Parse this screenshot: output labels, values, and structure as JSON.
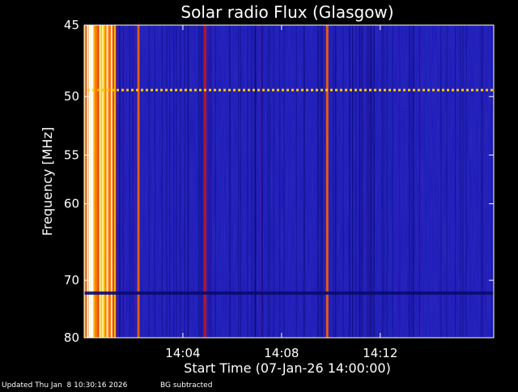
{
  "chart_data": {
    "type": "heatmap",
    "title": "Solar radio Flux (Glasgow)",
    "xlabel": "Start Time (07-Jan-26 14:00:00)",
    "ylabel": "Frequency [MHz]",
    "x_unit": "minutes after 14:00:00",
    "xlim": [
      0,
      16.6
    ],
    "ylim": [
      45,
      80
    ],
    "y_scale": "reciprocal",
    "x_ticks": [
      {
        "value": 4,
        "label": "14:04"
      },
      {
        "value": 8,
        "label": "14:08"
      },
      {
        "value": 12,
        "label": "14:12"
      }
    ],
    "y_ticks": [
      {
        "value": 45,
        "label": "45"
      },
      {
        "value": 50,
        "label": "50"
      },
      {
        "value": 55,
        "label": "55"
      },
      {
        "value": 60,
        "label": "60"
      },
      {
        "value": 70,
        "label": "70"
      },
      {
        "value": 80,
        "label": "80"
      }
    ],
    "colormap": [
      "#000000",
      "#0a0a6e",
      "#1e1ec8",
      "#5a0aa0",
      "#c81414",
      "#ff6400",
      "#ffc800",
      "#ffffb4"
    ],
    "features": [
      {
        "name": "broadband burst",
        "t_start": 0.0,
        "t_end": 1.3,
        "intensity": "high"
      },
      {
        "name": "vertical line",
        "t": 2.2,
        "intensity": "medium-high"
      },
      {
        "name": "vertical line",
        "t": 4.9,
        "intensity": "medium"
      },
      {
        "name": "vertical line",
        "t": 9.85,
        "intensity": "medium-high"
      },
      {
        "name": "RFI line",
        "freq": 49.5,
        "intensity": "high"
      },
      {
        "name": "horizontal band",
        "freq": 72,
        "intensity": "low"
      }
    ],
    "grid": false
  },
  "footer": {
    "updated": "Updated Thu Jan  8 10:30:16 2026",
    "note": "BG subtracted"
  }
}
